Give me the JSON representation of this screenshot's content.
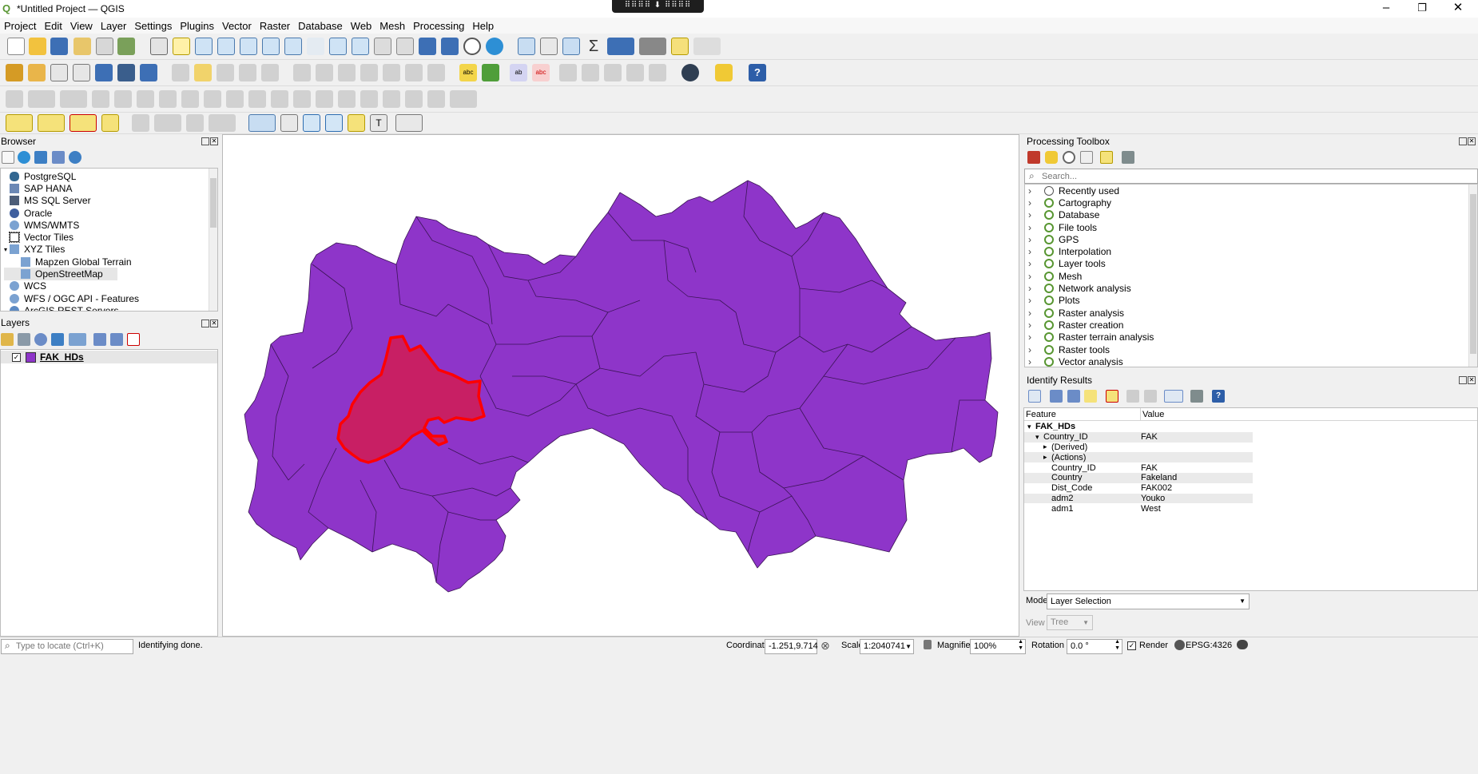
{
  "window": {
    "title": "*Untitled Project — QGIS",
    "grip_label": "⠿⠿⠿⠿ ⬇ ⠿⠿⠿⠿",
    "minimize": "–",
    "restore": "❐",
    "close": "✕"
  },
  "menu": [
    "Project",
    "Edit",
    "View",
    "Layer",
    "Settings",
    "Plugins",
    "Vector",
    "Raster",
    "Database",
    "Web",
    "Mesh",
    "Processing",
    "Help"
  ],
  "browser": {
    "title": "Browser",
    "items": [
      {
        "label": "PostgreSQL",
        "icon": "postgresql-icon"
      },
      {
        "label": "SAP HANA",
        "icon": "sap-hana-icon"
      },
      {
        "label": "MS SQL Server",
        "icon": "mssql-icon"
      },
      {
        "label": "Oracle",
        "icon": "oracle-icon"
      },
      {
        "label": "WMS/WMTS",
        "icon": "wms-icon"
      },
      {
        "label": "Vector Tiles",
        "icon": "vector-tiles-icon"
      },
      {
        "label": "XYZ Tiles",
        "icon": "xyz-tiles-icon"
      },
      {
        "label": "Mapzen Global Terrain",
        "icon": "tile-icon"
      },
      {
        "label": "OpenStreetMap",
        "icon": "tile-icon"
      },
      {
        "label": "WCS",
        "icon": "wcs-icon"
      },
      {
        "label": "WFS / OGC API - Features",
        "icon": "wfs-icon"
      },
      {
        "label": "ArcGIS REST Servers",
        "icon": "arcgis-icon"
      }
    ]
  },
  "layers": {
    "title": "Layers",
    "items": [
      {
        "label": "FAK_HDs",
        "color": "#8e35c9",
        "checked": true
      }
    ]
  },
  "processing": {
    "title": "Processing Toolbox",
    "search_placeholder": "Search...",
    "items": [
      "Recently used",
      "Cartography",
      "Database",
      "File tools",
      "GPS",
      "Interpolation",
      "Layer tools",
      "Mesh",
      "Network analysis",
      "Plots",
      "Raster analysis",
      "Raster creation",
      "Raster terrain analysis",
      "Raster tools",
      "Vector analysis"
    ]
  },
  "identify": {
    "title": "Identify Results",
    "col_feature": "Feature",
    "col_value": "Value",
    "rows": [
      {
        "feature": "FAK_HDs",
        "value": "",
        "indent": 0,
        "bold": true,
        "expander": "▾"
      },
      {
        "feature": "Country_ID",
        "value": "FAK",
        "indent": 1,
        "bold": false,
        "expander": "▾"
      },
      {
        "feature": "(Derived)",
        "value": "",
        "indent": 2,
        "bold": false,
        "expander": "▸"
      },
      {
        "feature": "(Actions)",
        "value": "",
        "indent": 2,
        "bold": false,
        "expander": "▸"
      },
      {
        "feature": "Country_ID",
        "value": "FAK",
        "indent": 2,
        "bold": false,
        "expander": ""
      },
      {
        "feature": "Country",
        "value": "Fakeland",
        "indent": 2,
        "bold": false,
        "expander": ""
      },
      {
        "feature": "Dist_Code",
        "value": "FAK002",
        "indent": 2,
        "bold": false,
        "expander": ""
      },
      {
        "feature": "adm2",
        "value": "Youko",
        "indent": 2,
        "bold": false,
        "expander": ""
      },
      {
        "feature": "adm1",
        "value": "West",
        "indent": 2,
        "bold": false,
        "expander": ""
      }
    ],
    "mode_label": "Mode",
    "mode_value": "Layer Selection",
    "view_label": "View",
    "view_value": "Tree"
  },
  "status": {
    "locate_placeholder": "Type to locate (Ctrl+K)",
    "message": "Identifying done.",
    "coordinate_label": "Coordinate",
    "coordinate": "-1.251,9.714",
    "scale_label": "Scale",
    "scale": "1:2040741",
    "magnifier_label": "Magnifier",
    "magnifier": "100%",
    "rotation_label": "Rotation",
    "rotation": "0.0 °",
    "render_label": "Render",
    "crs": "EPSG:4326"
  },
  "colors": {
    "district_fill": "#8e35c9",
    "selected_fill": "#c81f64",
    "selected_outline": "#ff0000",
    "qgis_green": "#589632"
  }
}
